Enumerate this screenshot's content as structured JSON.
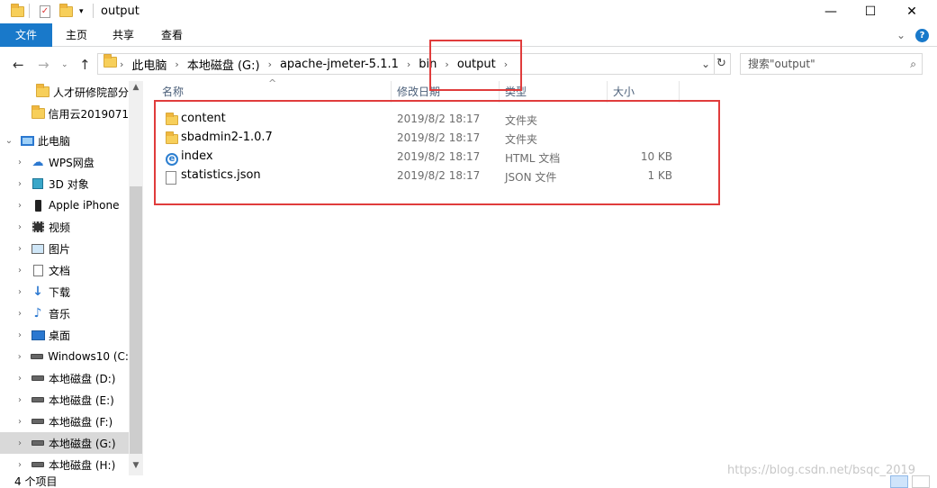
{
  "window": {
    "title": "output",
    "minimize_glyph": "—",
    "maximize_glyph": "☐",
    "close_glyph": "✕",
    "help_glyph": "?",
    "ribbon_collapse_glyph": "⌄"
  },
  "ribbon": {
    "tabs": [
      "文件",
      "主页",
      "共享",
      "查看"
    ]
  },
  "address": {
    "crumbs": [
      "此电脑",
      "本地磁盘 (G:)",
      "apache-jmeter-5.1.1",
      "bin",
      "output"
    ],
    "back_glyph": "←",
    "forward_glyph": "→",
    "up_glyph": "↑",
    "dropdown_glyph": "⌄",
    "refresh_glyph": "↻"
  },
  "search": {
    "placeholder": "搜索\"output\"",
    "icon": "search-icon"
  },
  "navpane": {
    "quick": [
      {
        "label": "人才研修院部分"
      },
      {
        "label": "信用云2019071"
      }
    ],
    "this_pc": "此电脑",
    "items": [
      {
        "label": "WPS网盘",
        "icon": "cloud-icon"
      },
      {
        "label": "3D 对象",
        "icon": "cube-icon"
      },
      {
        "label": "Apple iPhone",
        "icon": "phone-icon"
      },
      {
        "label": "视频",
        "icon": "video-icon"
      },
      {
        "label": "图片",
        "icon": "picture-icon"
      },
      {
        "label": "文档",
        "icon": "document-icon"
      },
      {
        "label": "下载",
        "icon": "download-icon"
      },
      {
        "label": "音乐",
        "icon": "music-icon"
      },
      {
        "label": "桌面",
        "icon": "desktop-icon"
      },
      {
        "label": "Windows10 (C:",
        "icon": "drive-icon"
      },
      {
        "label": "本地磁盘 (D:)",
        "icon": "drive-icon"
      },
      {
        "label": "本地磁盘 (E:)",
        "icon": "drive-icon"
      },
      {
        "label": "本地磁盘 (F:)",
        "icon": "drive-icon"
      },
      {
        "label": "本地磁盘 (G:)",
        "icon": "drive-icon",
        "selected": true
      },
      {
        "label": "本地磁盘 (H:)",
        "icon": "drive-icon"
      }
    ]
  },
  "columns": {
    "name": "名称",
    "date": "修改日期",
    "type": "类型",
    "size": "大小",
    "sort_glyph": "^"
  },
  "files": [
    {
      "name": "content",
      "date": "2019/8/2 18:17",
      "type": "文件夹",
      "size": "",
      "icon": "folder-icon"
    },
    {
      "name": "sbadmin2-1.0.7",
      "date": "2019/8/2 18:17",
      "type": "文件夹",
      "size": "",
      "icon": "folder-icon"
    },
    {
      "name": "index",
      "date": "2019/8/2 18:17",
      "type": "HTML 文档",
      "size": "10 KB",
      "icon": "html-file-icon"
    },
    {
      "name": "statistics.json",
      "date": "2019/8/2 18:17",
      "type": "JSON 文件",
      "size": "1 KB",
      "icon": "file-icon"
    }
  ],
  "status": {
    "count": "4 个项目"
  },
  "watermark": "https://blog.csdn.net/bsqc_2019",
  "colors": {
    "accent": "#1979ca",
    "highlight_box": "#e03c3c",
    "folder": "#f7cf5a"
  }
}
